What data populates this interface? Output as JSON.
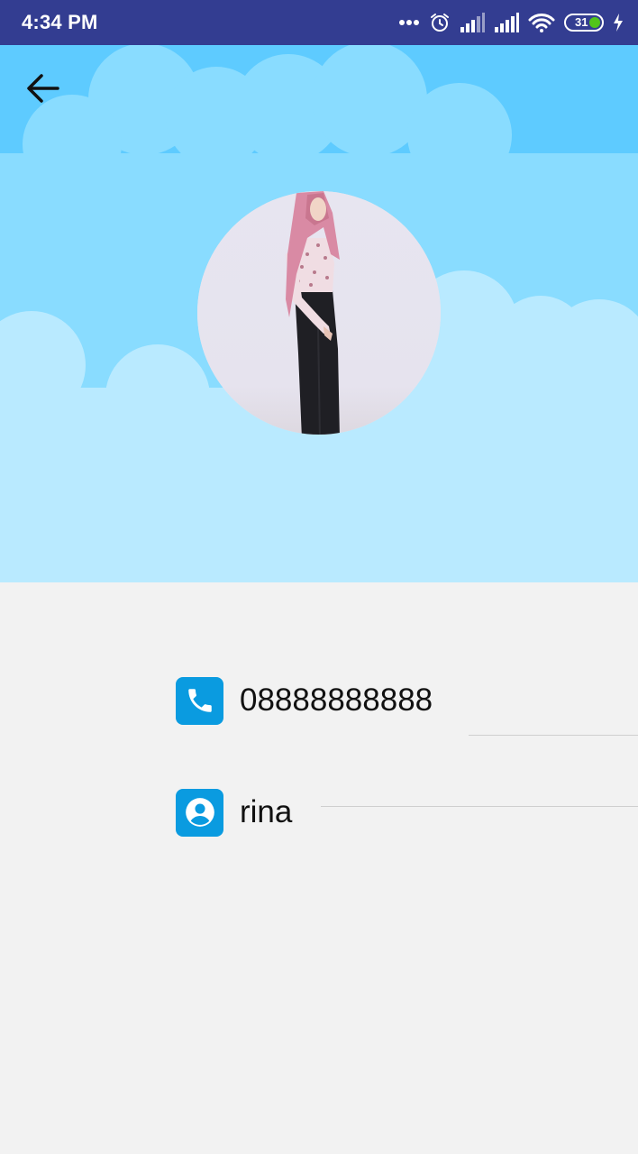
{
  "status_bar": {
    "time": "4:34 PM",
    "battery_level": "31",
    "icons": [
      "more-dots-icon",
      "alarm-icon",
      "signal-icon",
      "signal-icon",
      "wifi-icon",
      "battery-icon",
      "charging-icon"
    ]
  },
  "header": {
    "back_icon": "arrow-back-icon"
  },
  "profile": {
    "phone": "08888888888",
    "phone_icon": "phone-icon",
    "name": "rina",
    "name_icon": "account-circle-icon"
  },
  "colors": {
    "status_bar": "#333d91",
    "sky": "#5ecbff",
    "cloud_light": "#b9eaff",
    "accent": "#0a9be0",
    "background": "#f2f2f2"
  }
}
